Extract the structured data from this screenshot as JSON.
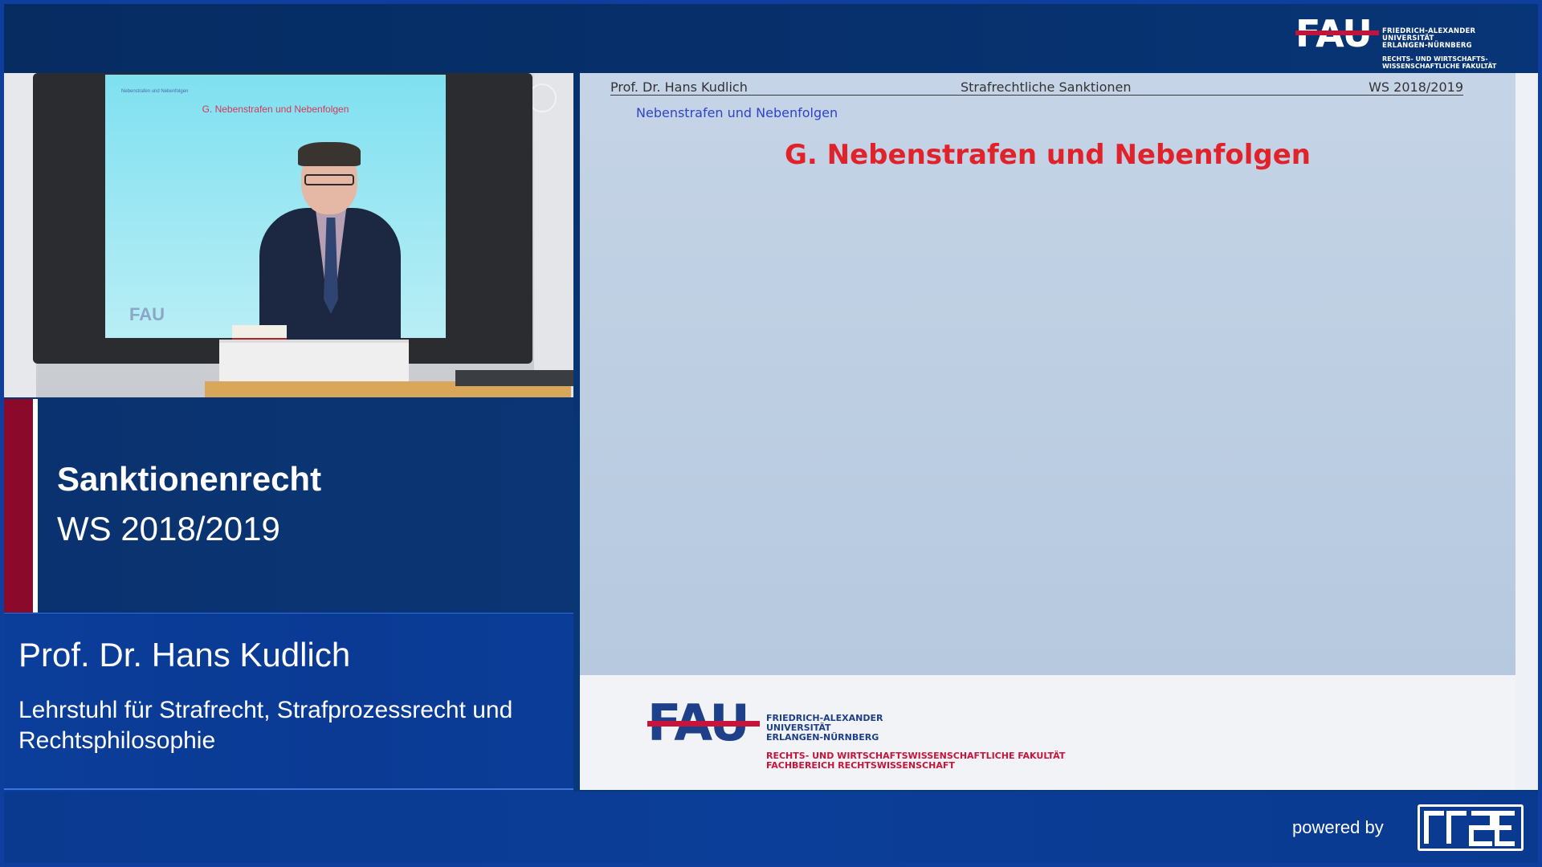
{
  "header": {
    "logo_mark": "FAU",
    "logo_text_line1": "FRIEDRICH-ALEXANDER",
    "logo_text_line2": "UNIVERSITÄT",
    "logo_text_line3": "ERLANGEN-NÜRNBERG",
    "logo_sub_line1": "RECHTS- UND WIRTSCHAFTS-",
    "logo_sub_line2": "WISSENSCHAFTLICHE FAKULTÄT"
  },
  "video": {
    "screen_title": "G. Nebenstrafen und Nebenfolgen",
    "screen_sub": "Nebenstrafen und Nebenfolgen",
    "screen_logo": "FAU"
  },
  "course": {
    "title": "Sanktionenrecht",
    "term": "WS 2018/2019"
  },
  "presenter": {
    "name": "Prof. Dr. Hans Kudlich",
    "chair": "Lehrstuhl für Strafrecht, Strafprozessrecht und Rechtsphilosophie"
  },
  "slide": {
    "header_left": "Prof. Dr. Hans Kudlich",
    "header_mid": "Strafrechtliche Sanktionen",
    "header_right": "WS 2018/2019",
    "section": "Nebenstrafen und Nebenfolgen",
    "heading": "G. Nebenstrafen und Nebenfolgen",
    "footer_logo_mark": "FAU",
    "footer_uni_line1": "FRIEDRICH-ALEXANDER",
    "footer_uni_line2": "UNIVERSITÄT",
    "footer_uni_line3": "ERLANGEN-NÜRNBERG",
    "footer_fac_line1": "RECHTS- UND WIRTSCHAFTSWISSENSCHAFTLICHE FAKULTÄT",
    "footer_fac_line2": "FACHBEREICH RECHTSWISSENSCHAFT"
  },
  "footer": {
    "powered_by": "powered by",
    "rrze_logo_icon": "rrze-logo-icon"
  },
  "colors": {
    "brand_blue": "#0b3272",
    "accent_red": "#8b0a2b",
    "slide_heading_red": "#e0222a",
    "slide_section_blue": "#2f44c4"
  }
}
